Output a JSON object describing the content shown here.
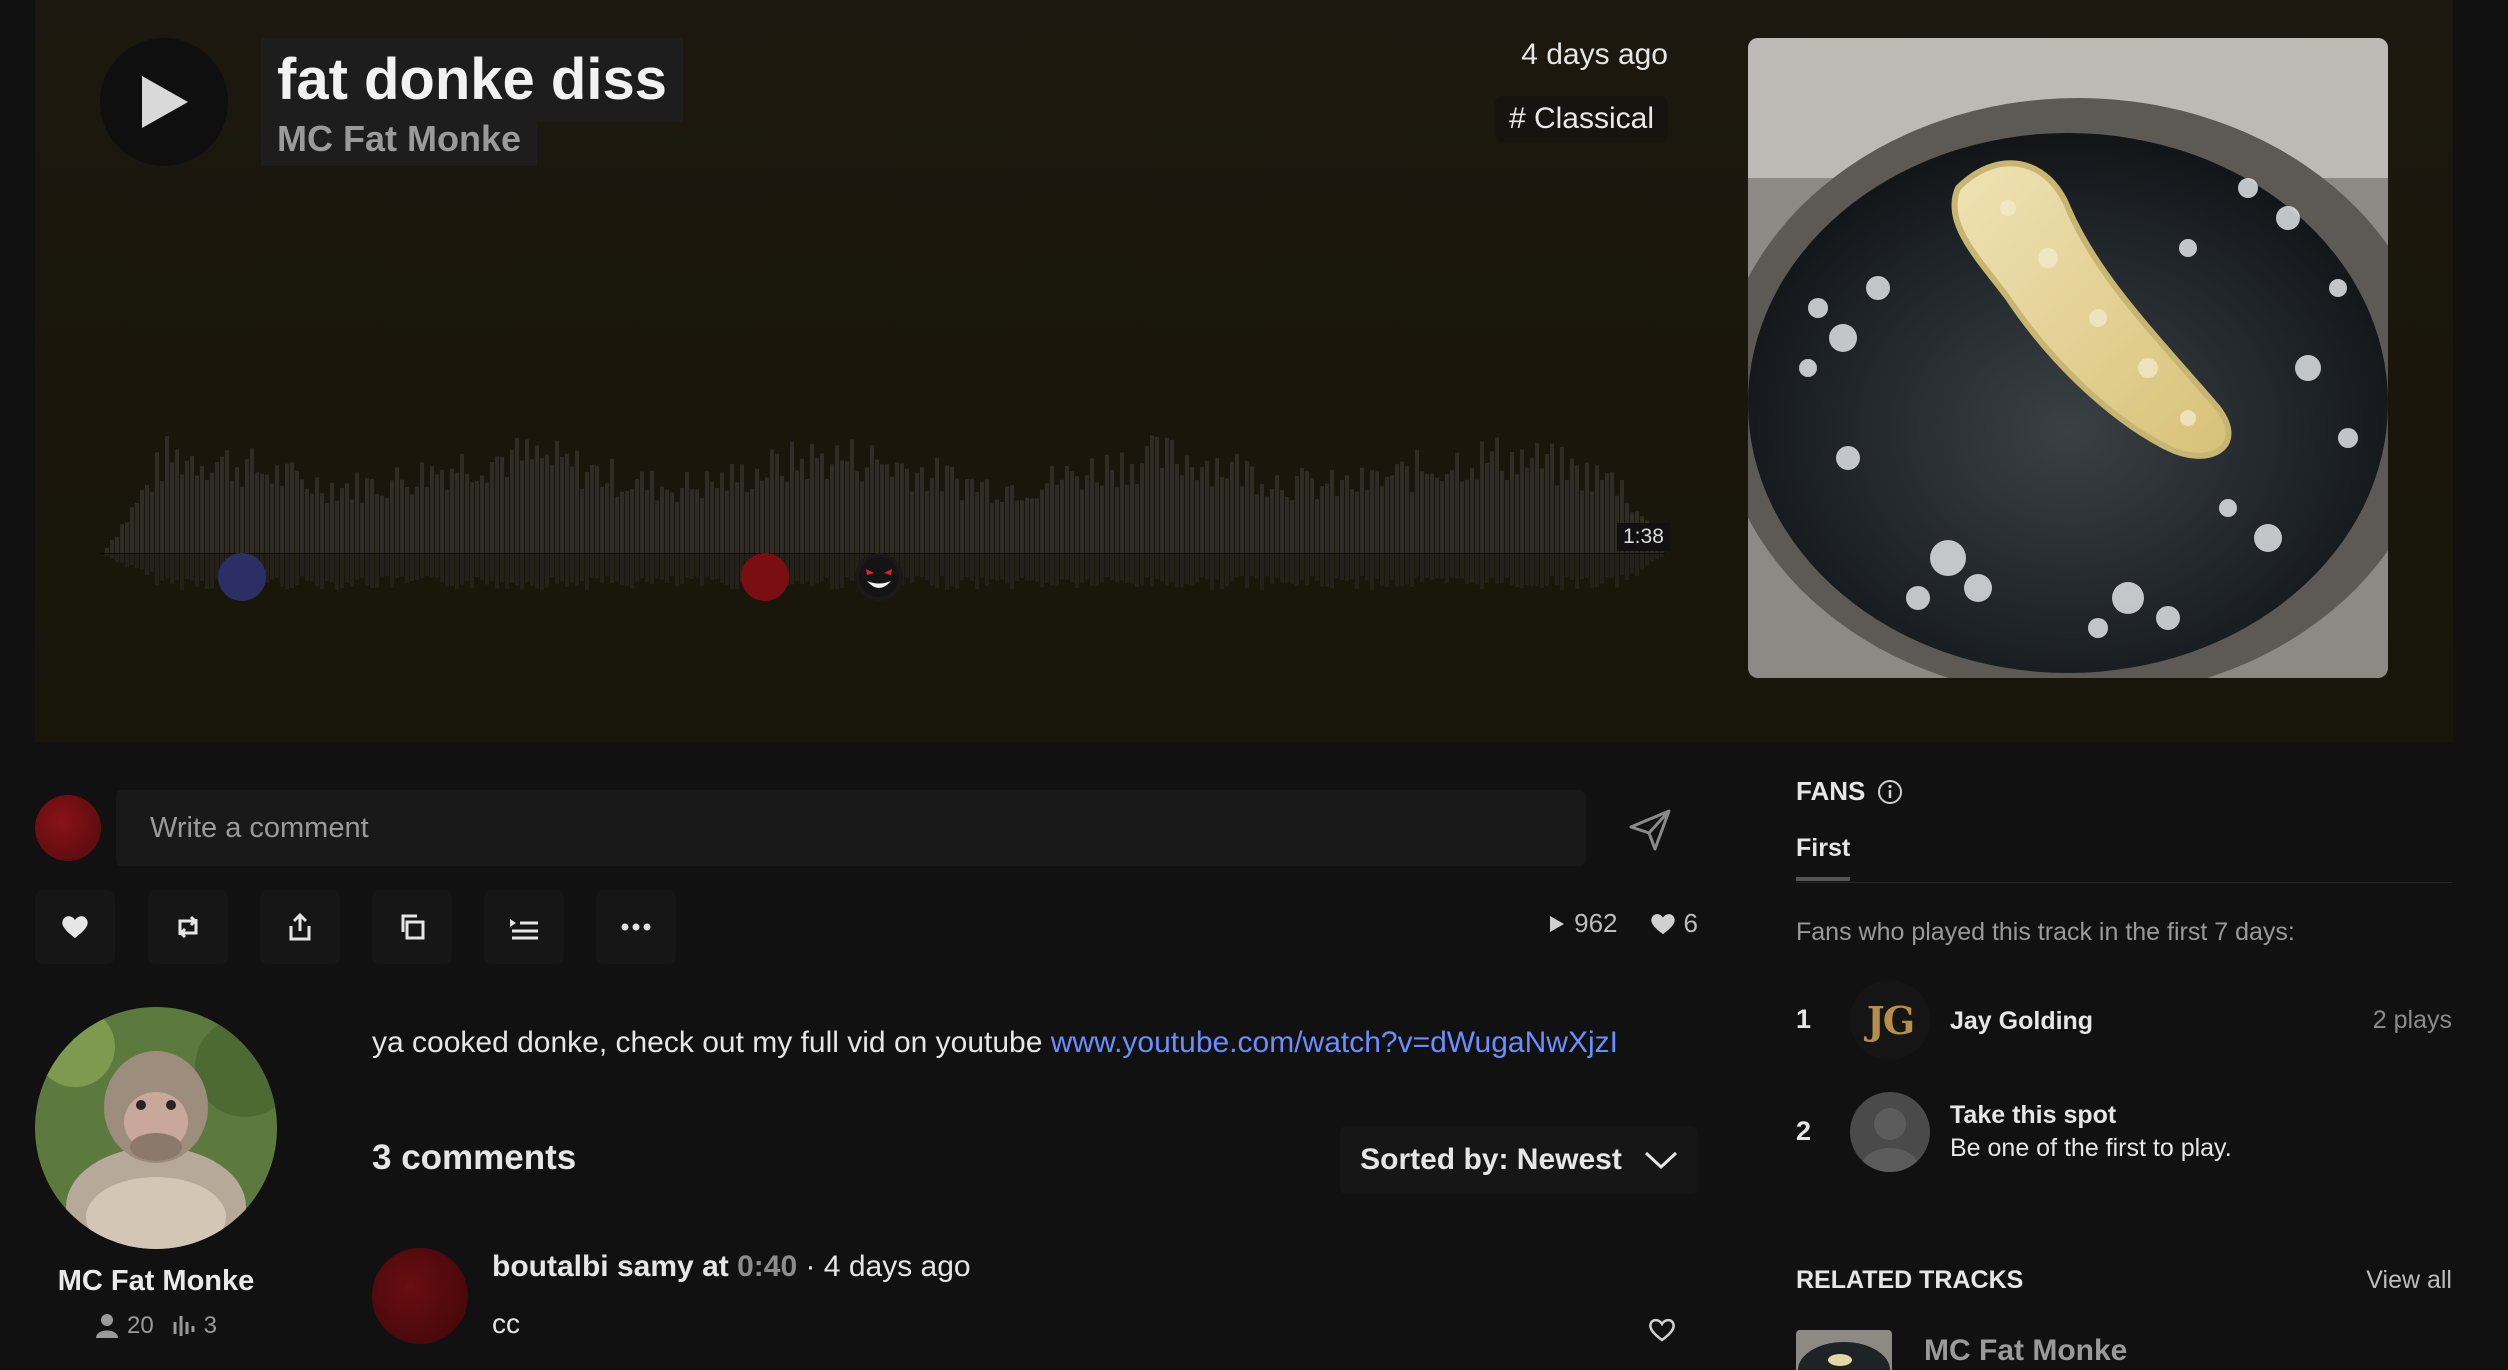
{
  "track": {
    "title": "fat donke diss",
    "artist": "MC Fat Monke",
    "posted": "4 days ago",
    "genre": "# Classical",
    "duration": "1:38"
  },
  "comment_box": {
    "placeholder": "Write a comment"
  },
  "stats": {
    "plays": "962",
    "likes": "6"
  },
  "uploader": {
    "name": "MC Fat Monke",
    "followers": "20",
    "tracks": "3"
  },
  "description": {
    "text": "ya cooked donke, check out my full vid on youtube ",
    "link": "www.youtube.com/watch?v=dWugaNwXjzI"
  },
  "comments": {
    "count_label": "3 comments",
    "sort_label": "Sorted by: Newest",
    "items": [
      {
        "user": "boutalbi samy",
        "at_label": "at",
        "time": "0:40",
        "age": "· 4 days ago",
        "body": "cc"
      }
    ]
  },
  "fans": {
    "heading": "FANS",
    "tab": "First",
    "subtitle": "Fans who played this track in the first 7 days:",
    "list": [
      {
        "rank": "1",
        "initials": "JG",
        "name": "Jay Golding",
        "plays": "2 plays"
      },
      {
        "rank": "2",
        "title": "Take this spot",
        "subtitle": "Be one of the first to play."
      }
    ]
  },
  "related": {
    "heading": "RELATED TRACKS",
    "view_all": "View all",
    "items": [
      {
        "artist": "MC Fat Monke"
      }
    ]
  },
  "colors": {
    "accent_link": "#6c8dff",
    "hero_bg": "#1c180f",
    "page_bg": "#111111"
  }
}
